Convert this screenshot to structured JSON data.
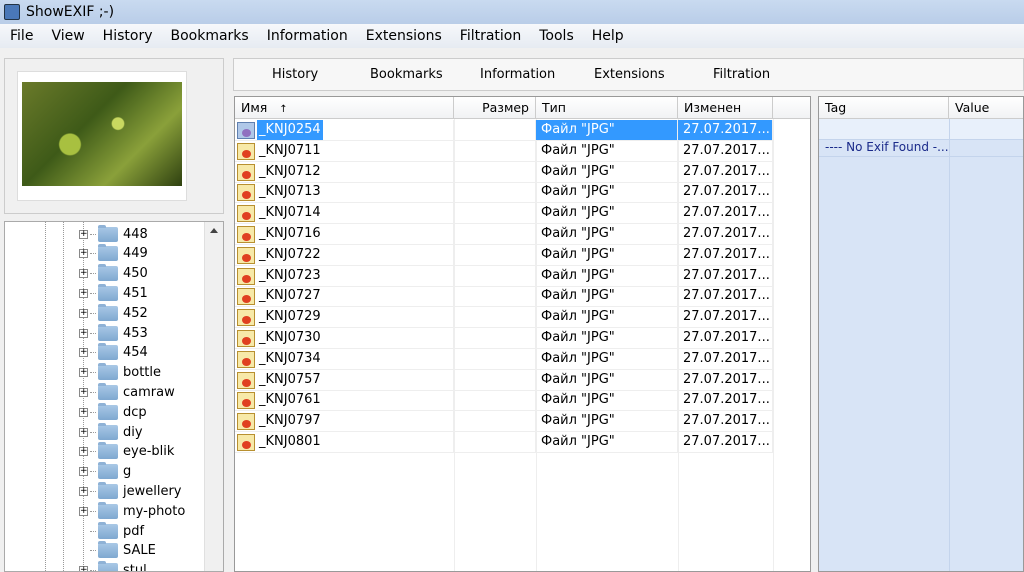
{
  "window": {
    "title": "ShowEXIF ;-)"
  },
  "menu": [
    "File",
    "View",
    "History",
    "Bookmarks",
    "Information",
    "Extensions",
    "Filtration",
    "Tools",
    "Help"
  ],
  "tabs": [
    "History",
    "Bookmarks",
    "Information",
    "Extensions",
    "Filtration"
  ],
  "tree": [
    {
      "label": "448",
      "expandable": true
    },
    {
      "label": "449",
      "expandable": true
    },
    {
      "label": "450",
      "expandable": true
    },
    {
      "label": "451",
      "expandable": true
    },
    {
      "label": "452",
      "expandable": true
    },
    {
      "label": "453",
      "expandable": true
    },
    {
      "label": "454",
      "expandable": true
    },
    {
      "label": "bottle",
      "expandable": true
    },
    {
      "label": "camraw",
      "expandable": true
    },
    {
      "label": "dcp",
      "expandable": true
    },
    {
      "label": "diy",
      "expandable": true
    },
    {
      "label": "eye-blik",
      "expandable": true
    },
    {
      "label": "g",
      "expandable": true
    },
    {
      "label": "jewellery",
      "expandable": true
    },
    {
      "label": "my-photo",
      "expandable": true
    },
    {
      "label": "pdf",
      "expandable": false
    },
    {
      "label": "SALE",
      "expandable": false
    },
    {
      "label": "stul",
      "expandable": true
    }
  ],
  "files": {
    "columns": [
      "Имя",
      "Размер",
      "Тип",
      "Изменен"
    ],
    "sort_indicator": "↑",
    "rows": [
      {
        "name": "_KNJ0254",
        "size": "",
        "type": "Файл \"JPG\"",
        "modified": "27.07.2017...",
        "selected": true
      },
      {
        "name": "_KNJ0711",
        "size": "",
        "type": "Файл \"JPG\"",
        "modified": "27.07.2017..."
      },
      {
        "name": "_KNJ0712",
        "size": "",
        "type": "Файл \"JPG\"",
        "modified": "27.07.2017..."
      },
      {
        "name": "_KNJ0713",
        "size": "",
        "type": "Файл \"JPG\"",
        "modified": "27.07.2017..."
      },
      {
        "name": "_KNJ0714",
        "size": "",
        "type": "Файл \"JPG\"",
        "modified": "27.07.2017..."
      },
      {
        "name": "_KNJ0716",
        "size": "",
        "type": "Файл \"JPG\"",
        "modified": "27.07.2017..."
      },
      {
        "name": "_KNJ0722",
        "size": "",
        "type": "Файл \"JPG\"",
        "modified": "27.07.2017..."
      },
      {
        "name": "_KNJ0723",
        "size": "",
        "type": "Файл \"JPG\"",
        "modified": "27.07.2017..."
      },
      {
        "name": "_KNJ0727",
        "size": "",
        "type": "Файл \"JPG\"",
        "modified": "27.07.2017..."
      },
      {
        "name": "_KNJ0729",
        "size": "",
        "type": "Файл \"JPG\"",
        "modified": "27.07.2017..."
      },
      {
        "name": "_KNJ0730",
        "size": "",
        "type": "Файл \"JPG\"",
        "modified": "27.07.2017..."
      },
      {
        "name": "_KNJ0734",
        "size": "",
        "type": "Файл \"JPG\"",
        "modified": "27.07.2017..."
      },
      {
        "name": "_KNJ0757",
        "size": "",
        "type": "Файл \"JPG\"",
        "modified": "27.07.2017..."
      },
      {
        "name": "_KNJ0761",
        "size": "",
        "type": "Файл \"JPG\"",
        "modified": "27.07.2017..."
      },
      {
        "name": "_KNJ0797",
        "size": "",
        "type": "Файл \"JPG\"",
        "modified": "27.07.2017..."
      },
      {
        "name": "_KNJ0801",
        "size": "",
        "type": "Файл \"JPG\"",
        "modified": "27.07.2017..."
      }
    ]
  },
  "exif": {
    "columns": [
      "Tag",
      "Value"
    ],
    "message": "---- No Exif Found -..."
  }
}
